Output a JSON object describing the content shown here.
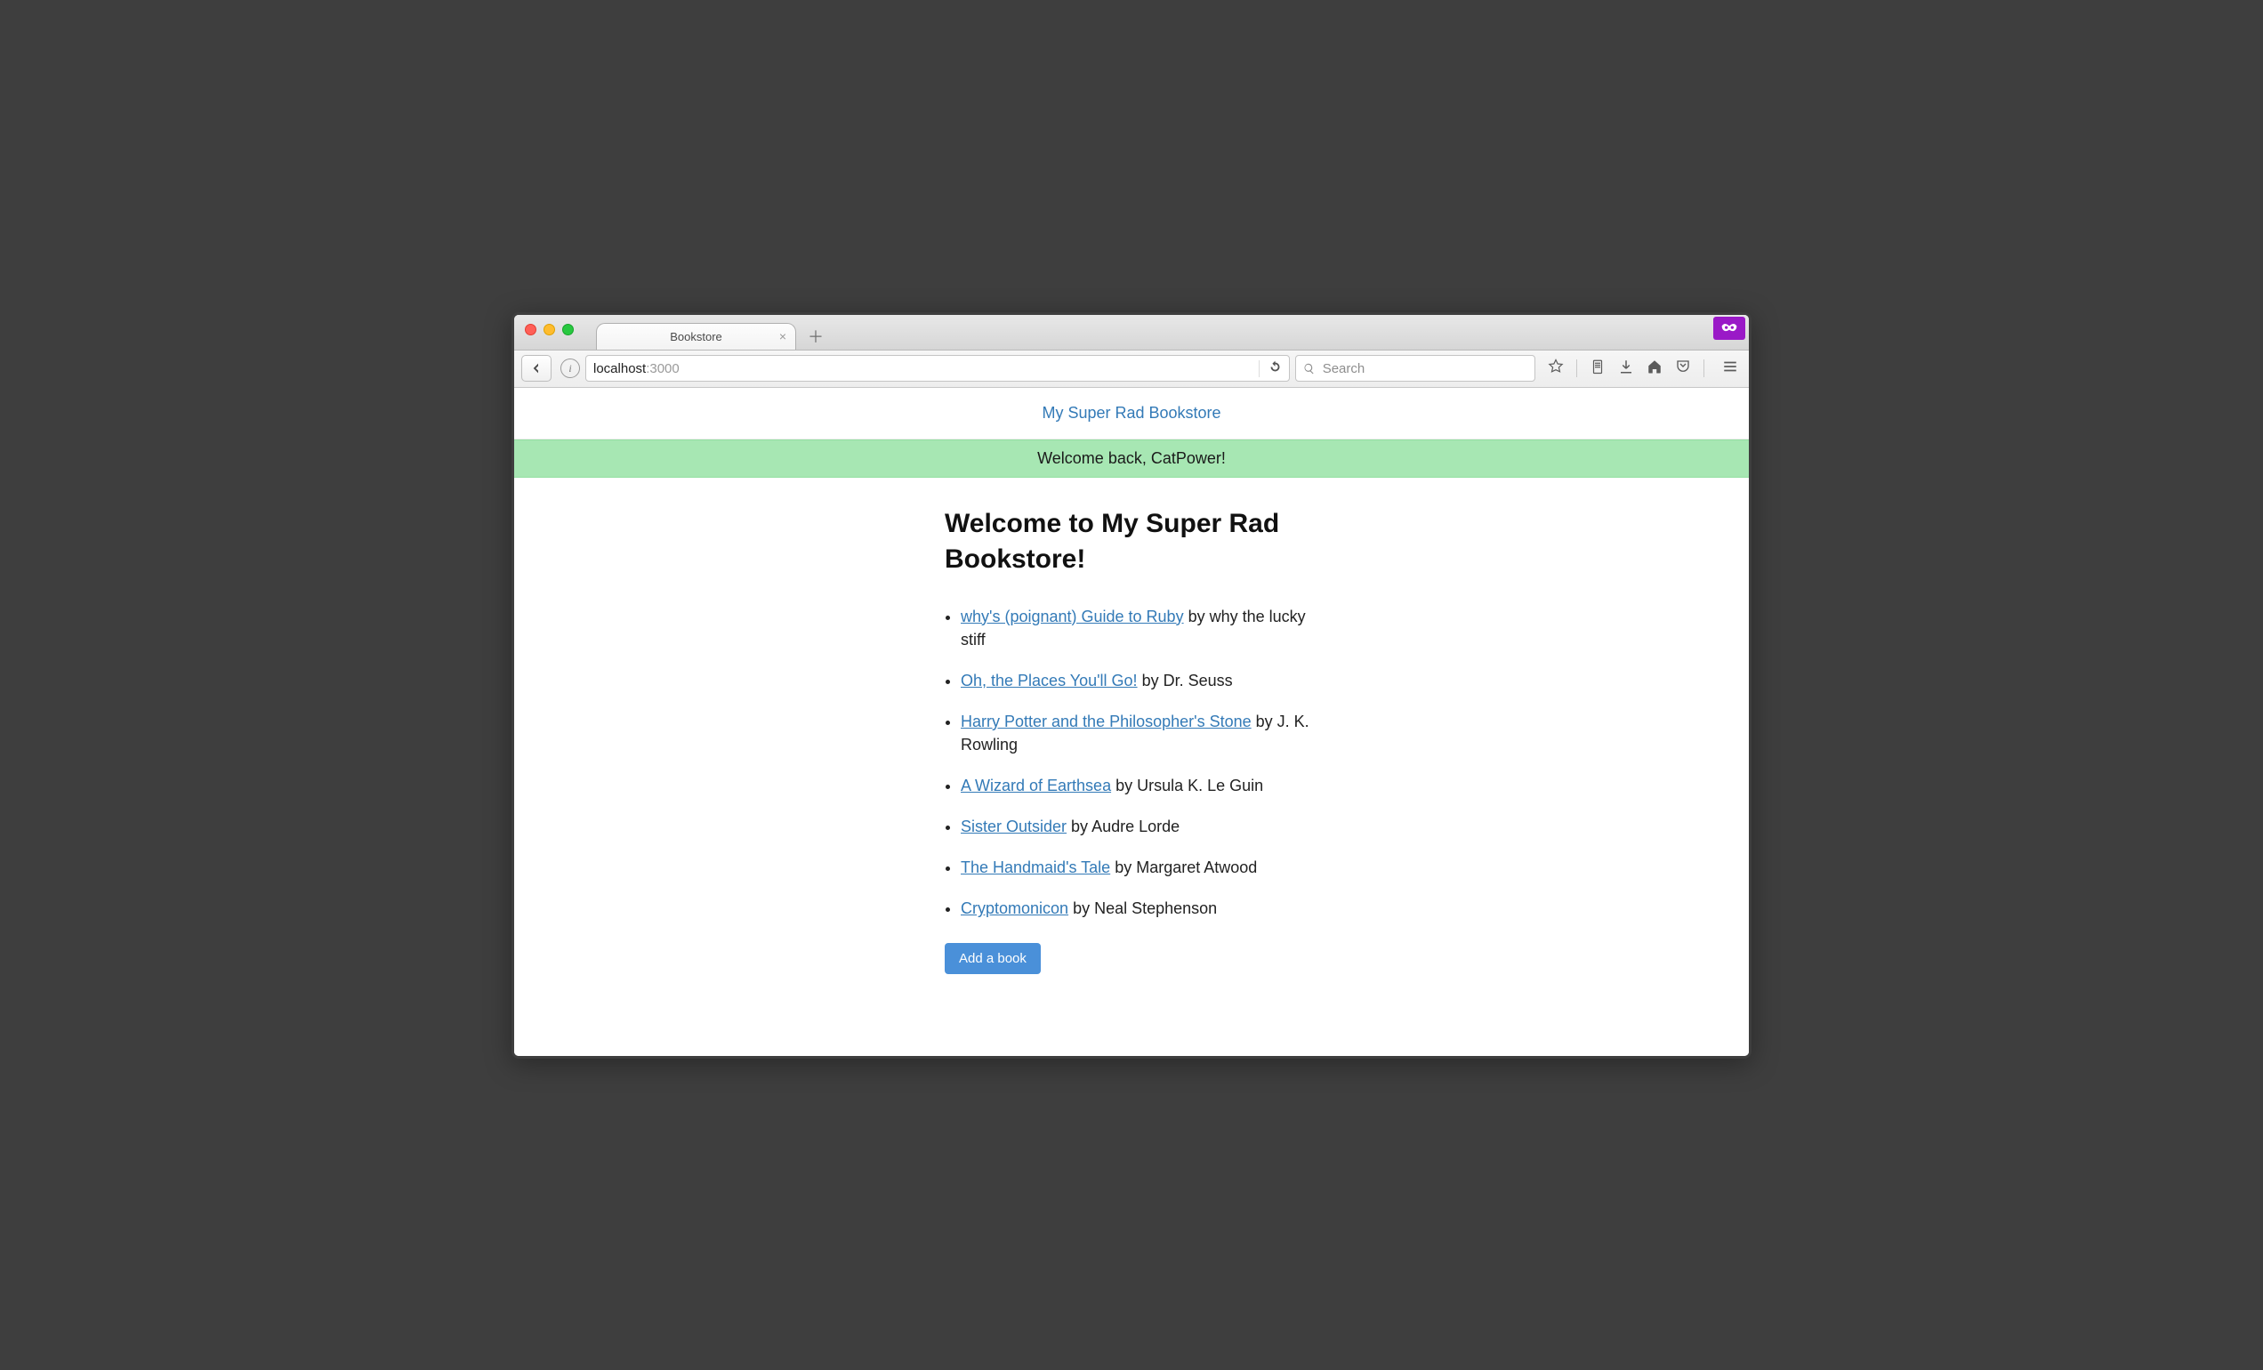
{
  "window": {
    "tab_title": "Bookstore"
  },
  "toolbar": {
    "url_host": "localhost",
    "url_port": ":3000",
    "search_placeholder": "Search"
  },
  "page": {
    "brand_link": "My Super Rad Bookstore",
    "flash_message": "Welcome back, CatPower!",
    "heading": "Welcome to My Super Rad Bookstore!",
    "by_word": " by ",
    "add_button": "Add a book",
    "books": [
      {
        "title": "why's (poignant) Guide to Ruby",
        "author": "why the lucky stiff"
      },
      {
        "title": "Oh, the Places You'll Go!",
        "author": "Dr. Seuss"
      },
      {
        "title": "Harry Potter and the Philosopher's Stone",
        "author": "J. K. Rowling"
      },
      {
        "title": "A Wizard of Earthsea",
        "author": "Ursula K. Le Guin"
      },
      {
        "title": "Sister Outsider",
        "author": "Audre Lorde"
      },
      {
        "title": "The Handmaid's Tale",
        "author": "Margaret Atwood"
      },
      {
        "title": "Cryptomonicon",
        "author": "Neal Stephenson"
      }
    ]
  }
}
